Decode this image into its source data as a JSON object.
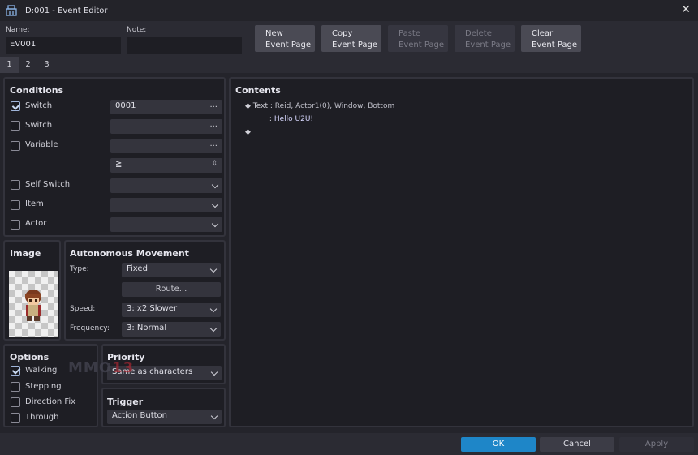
{
  "window": {
    "title": "ID:001 - Event Editor",
    "close_glyph": "✕"
  },
  "header": {
    "name_label": "Name:",
    "name_value": "EV001",
    "note_label": "Note:",
    "note_value": "",
    "buttons": [
      {
        "line1": "New",
        "line2": "Event Page",
        "enabled": true
      },
      {
        "line1": "Copy",
        "line2": "Event Page",
        "enabled": true
      },
      {
        "line1": "Paste",
        "line2": "Event Page",
        "enabled": false
      },
      {
        "line1": "Delete",
        "line2": "Event Page",
        "enabled": false
      },
      {
        "line1": "Clear",
        "line2": "Event Page",
        "enabled": true
      }
    ]
  },
  "tabs": [
    "1",
    "2",
    "3"
  ],
  "active_tab": "1",
  "conditions": {
    "title": "Conditions",
    "switch1": {
      "label": "Switch",
      "checked": true,
      "value": "0001",
      "dots": "..."
    },
    "switch2": {
      "label": "Switch",
      "checked": false,
      "value": "",
      "dots": "..."
    },
    "variable": {
      "label": "Variable",
      "checked": false,
      "value": "",
      "dots": "...",
      "operator": "≧",
      "spinner": "⇕"
    },
    "self_switch": {
      "label": "Self Switch",
      "checked": false,
      "value": ""
    },
    "item": {
      "label": "Item",
      "checked": false,
      "value": ""
    },
    "actor": {
      "label": "Actor",
      "checked": false,
      "value": ""
    }
  },
  "image": {
    "title": "Image",
    "sprite": "actor-character-sprite"
  },
  "autonomous": {
    "title": "Autonomous Movement",
    "type_label": "Type:",
    "type_value": "Fixed",
    "route_label": "Route...",
    "speed_label": "Speed:",
    "speed_value": "3: x2 Slower",
    "frequency_label": "Frequency:",
    "frequency_value": "3: Normal"
  },
  "options": {
    "title": "Options",
    "walking": {
      "label": "Walking",
      "checked": true
    },
    "stepping": {
      "label": "Stepping",
      "checked": false
    },
    "direction_fix": {
      "label": "Direction Fix",
      "checked": false
    },
    "through": {
      "label": "Through",
      "checked": false
    }
  },
  "priority": {
    "title": "Priority",
    "value": "Same as characters"
  },
  "trigger": {
    "title": "Trigger",
    "value": "Action Button"
  },
  "contents": {
    "title": "Contents",
    "lines": [
      {
        "bullet": "◆",
        "command": "Text",
        "sep": ":",
        "args": "Reid, Actor1(0), Window, Bottom"
      },
      {
        "bullet": "",
        "command": ":",
        "sep": ":",
        "args": "Hello U2U!"
      },
      {
        "bullet": "◆",
        "command": "",
        "sep": "",
        "args": ""
      }
    ]
  },
  "footer": {
    "ok": "OK",
    "cancel": "Cancel",
    "apply": "Apply"
  },
  "watermark": {
    "text_a": "MMO",
    "text_b": "13"
  },
  "colors": {
    "accent": "#1e86c8",
    "panel": "#1e1e24",
    "background": "#2b2b33"
  }
}
